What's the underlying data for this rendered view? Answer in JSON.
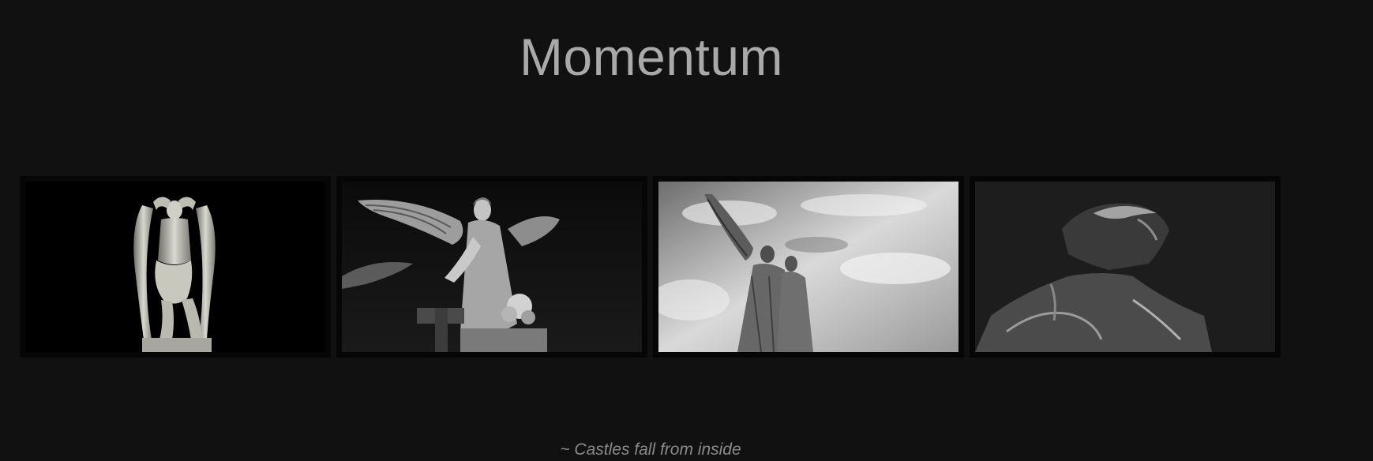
{
  "page": {
    "title": "Momentum",
    "caption": "~ Castles fall from inside"
  },
  "gallery": {
    "photos": [
      {
        "subject": "seated-winged-statue",
        "tone": "black-background"
      },
      {
        "subject": "angel-statue-with-bouquet",
        "tone": "dark-sky"
      },
      {
        "subject": "two-angel-statues",
        "tone": "cloudy-sky"
      },
      {
        "subject": "statue-head-upturned",
        "tone": "dark-background"
      }
    ]
  },
  "colors": {
    "background": "#111111",
    "title": "#a9a9a9",
    "caption": "#8a8a8a",
    "frame": "#060606"
  }
}
